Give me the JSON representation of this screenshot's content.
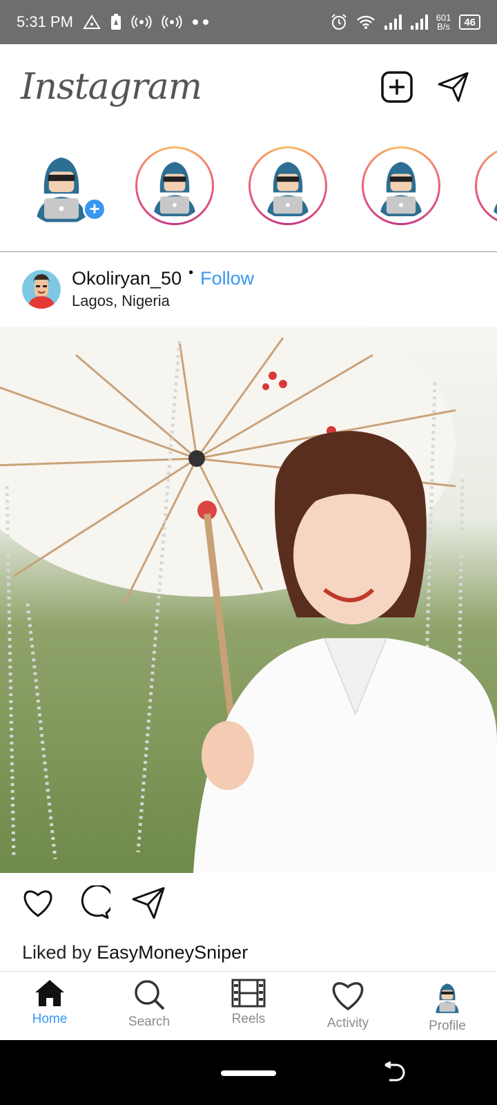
{
  "status_bar": {
    "time": "5:31 PM",
    "speed_value": "601",
    "speed_unit": "B/s",
    "battery": "46"
  },
  "app": {
    "title": "Instagram",
    "icons": {
      "new_post": "plus-square-icon",
      "direct": "paper-plane-icon"
    }
  },
  "stories": [
    {
      "type": "own",
      "badge": "+"
    },
    {
      "type": "ring"
    },
    {
      "type": "ring"
    },
    {
      "type": "ring"
    },
    {
      "type": "ring"
    }
  ],
  "post": {
    "username": "Okoliryan_50",
    "separator": "•",
    "follow_label": "Follow",
    "location": "Lagos, Nigeria",
    "liked_prefix": "Liked by ",
    "liked_user": "EasyMoneySniper"
  },
  "bottom_nav": [
    {
      "id": "home",
      "label": "Home",
      "active": true
    },
    {
      "id": "search",
      "label": "Search",
      "active": false
    },
    {
      "id": "reels",
      "label": "Reels",
      "active": false
    },
    {
      "id": "activity",
      "label": "Activity",
      "active": false
    },
    {
      "id": "profile",
      "label": "Profile",
      "active": false
    }
  ],
  "colors": {
    "accent": "#3897f0",
    "status_bar": "#6e6e6e"
  }
}
